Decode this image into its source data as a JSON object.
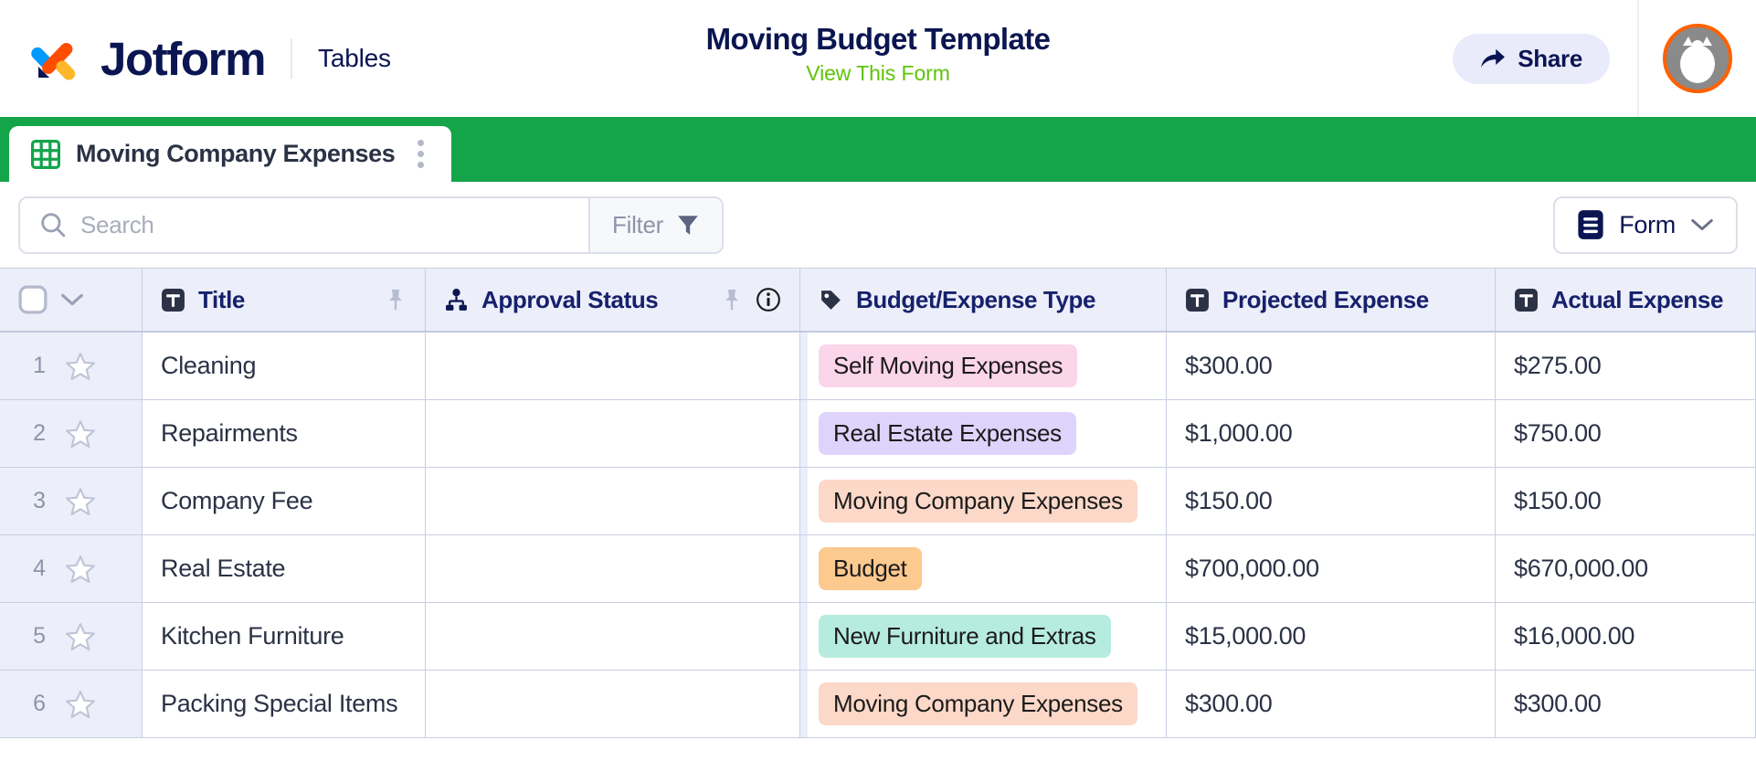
{
  "header": {
    "brand_name": "Jotform",
    "product_label": "Tables",
    "form_title": "Moving Budget Template",
    "view_form_link": "View This Form",
    "share_label": "Share",
    "logo_icon": "jotform-logo-icon",
    "share_icon": "share-arrow-icon",
    "avatar_icon": "user-avatar-icon",
    "colors": {
      "navy": "#0a1551",
      "green_link": "#5fc30a",
      "share_bg": "#e9ebfa",
      "avatar_ring": "#ff6100"
    }
  },
  "tabs": {
    "active_tab_label": "Moving Company Expenses",
    "tab_icon": "grid-table-icon",
    "menu_icon": "kebab-menu-icon",
    "strip_color": "#14a44a"
  },
  "toolbar": {
    "search_placeholder": "Search",
    "search_value": "",
    "search_icon": "search-icon",
    "filter_label": "Filter",
    "filter_icon": "funnel-icon",
    "form_label": "Form",
    "form_icon": "form-document-icon",
    "form_chevron_icon": "chevron-down-icon"
  },
  "table": {
    "select_all_checkbox": "row-select-all-checkbox",
    "gutter_chevron_icon": "chevron-down-icon",
    "columns": [
      {
        "label": "Title",
        "icon": "text-field-icon",
        "pin_icon": "pin-icon",
        "info_icon": null
      },
      {
        "label": "Approval Status",
        "icon": "approval-flow-icon",
        "pin_icon": "pin-icon",
        "info_icon": "info-icon"
      },
      {
        "label": "Budget/Expense Type",
        "icon": "tag-icon",
        "pin_icon": null,
        "info_icon": null
      },
      {
        "label": "Projected Expense",
        "icon": "text-field-icon",
        "pin_icon": null,
        "info_icon": null
      },
      {
        "label": "Actual Expense",
        "icon": "text-field-icon",
        "pin_icon": null,
        "info_icon": null
      }
    ],
    "rows": [
      {
        "num": "1",
        "star_icon": "star-icon",
        "title": "Cleaning",
        "approval_status": "",
        "type": "Self Moving Expenses",
        "type_color": "#fbd5ea",
        "projected": "$300.00",
        "actual": "$275.00"
      },
      {
        "num": "2",
        "star_icon": "star-icon",
        "title": "Repairments",
        "approval_status": "",
        "type": "Real Estate Expenses",
        "type_color": "#ded4fb",
        "projected": "$1,000.00",
        "actual": "$750.00"
      },
      {
        "num": "3",
        "star_icon": "star-icon",
        "title": "Company Fee",
        "approval_status": "",
        "type": "Moving Company Expenses",
        "type_color": "#fcd8c8",
        "projected": "$150.00",
        "actual": "$150.00"
      },
      {
        "num": "4",
        "star_icon": "star-icon",
        "title": "Real Estate",
        "approval_status": "",
        "type": "Budget",
        "type_color": "#fcc98f",
        "projected": "$700,000.00",
        "actual": "$670,000.00"
      },
      {
        "num": "5",
        "star_icon": "star-icon",
        "title": "Kitchen Furniture",
        "approval_status": "",
        "type": "New Furniture and Extras",
        "type_color": "#b6ecdf",
        "projected": "$15,000.00",
        "actual": "$16,000.00"
      },
      {
        "num": "6",
        "star_icon": "star-icon",
        "title": "Packing Special Items",
        "approval_status": "",
        "type": "Moving Company Expenses",
        "type_color": "#fcd8c8",
        "projected": "$300.00",
        "actual": "$300.00"
      }
    ]
  }
}
